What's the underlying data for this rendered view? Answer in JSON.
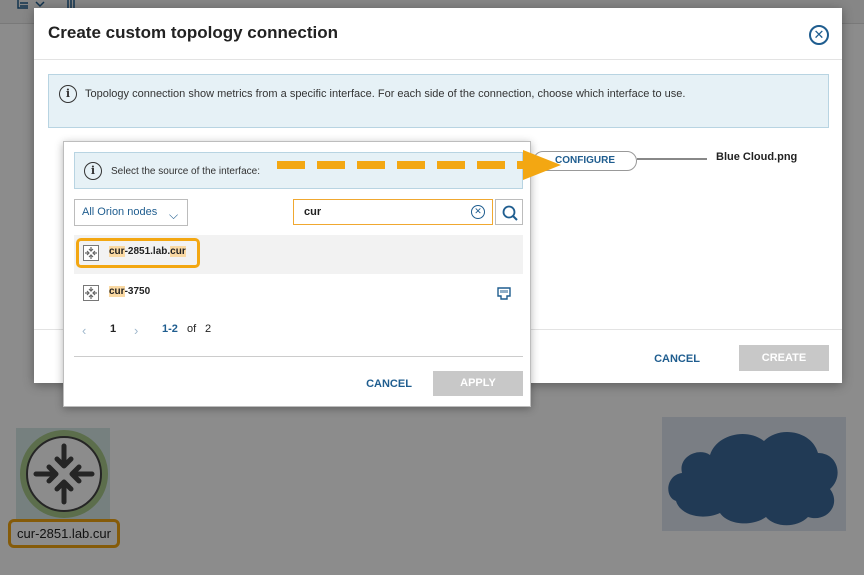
{
  "dialog": {
    "title": "Create custom topology connection",
    "info_text": "Topology connection show metrics from a specific interface. For each side of the connection, choose which interface to use.",
    "configure_label": "CONFIGURE",
    "target_label": "Blue Cloud.png",
    "cancel_label": "CANCEL",
    "create_label": "CREATE"
  },
  "popup": {
    "info_text": "Select the source of the interface:",
    "dropdown_value": "All Orion nodes",
    "search": {
      "value": "cur"
    },
    "results": [
      {
        "prefix": "cur",
        "middle": "-2851.lab.",
        "suffix": "cur"
      },
      {
        "prefix": "cur",
        "middle": "-3750",
        "suffix": ""
      }
    ],
    "pager": {
      "prev": "‹",
      "current": "1",
      "next": "›",
      "range": "1-2",
      "of": "of",
      "total": "2"
    },
    "cancel_label": "CANCEL",
    "apply_label": "APPLY"
  },
  "background": {
    "node_label": "cur-2851.lab.cur"
  },
  "colors": {
    "accent": "#1f5d8f",
    "highlight": "#f3a712",
    "disabled_button": "#c8c8c8",
    "info_background": "#e6f1f6"
  },
  "icons": [
    "filter-icon",
    "delete-icon",
    "info-icon",
    "close-icon",
    "chevron-down-icon",
    "clear-icon",
    "search-icon",
    "node-icon",
    "network-port-icon",
    "router-icon",
    "cloud-icon",
    "arrow-annotation"
  ]
}
